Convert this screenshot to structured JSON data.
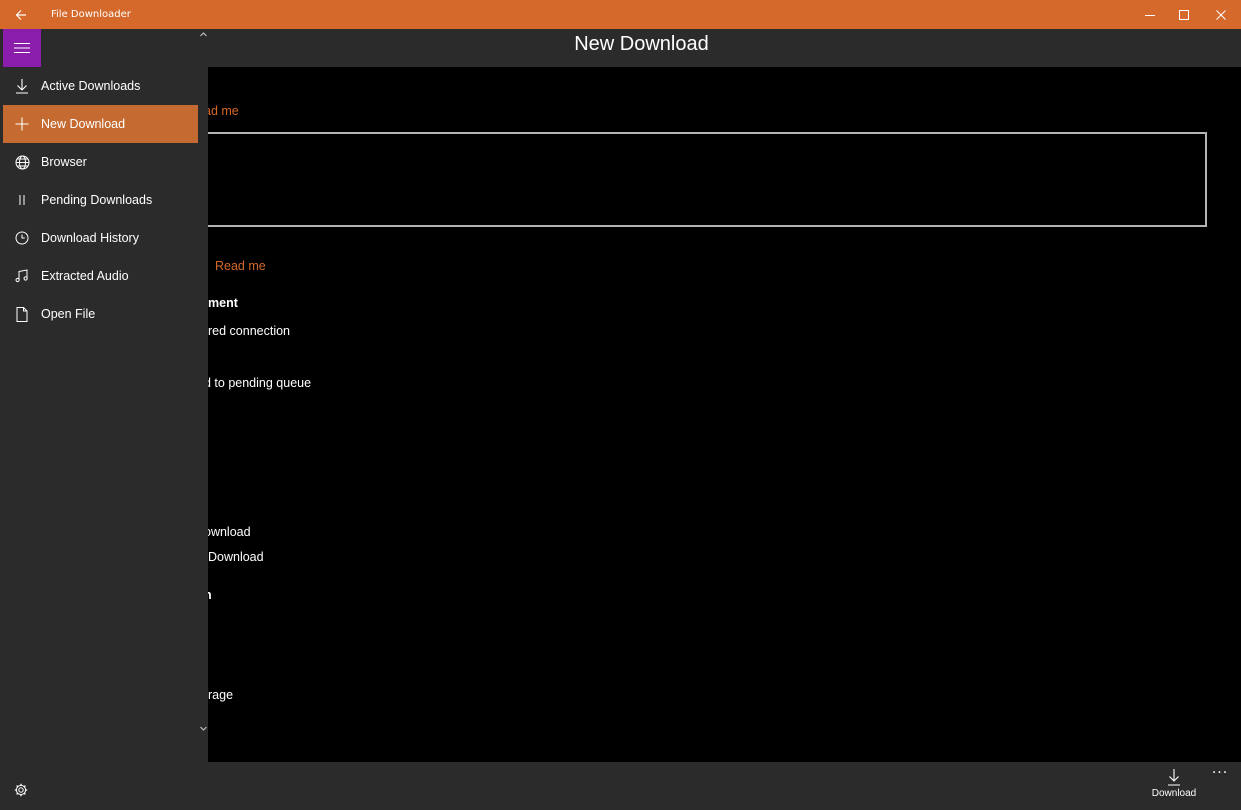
{
  "window": {
    "title": "File Downloader",
    "accent": "#d4692b"
  },
  "header": {
    "title": "New Download"
  },
  "content": {
    "link_1": "ad me",
    "link_2": "Read me",
    "heading_1": "ment",
    "lines": [
      "red connection",
      "d to pending queue",
      "ownload",
      "Download",
      "n",
      "rage"
    ]
  },
  "nav": {
    "hamburger_color": "#8a1dab",
    "items": [
      {
        "label": "Active Downloads",
        "icon": "download-icon"
      },
      {
        "label": "New Download",
        "icon": "plus-icon",
        "selected": true
      },
      {
        "label": "Browser",
        "icon": "globe-icon"
      },
      {
        "label": "Pending Downloads",
        "icon": "pause-icon"
      },
      {
        "label": "Download History",
        "icon": "clock-icon"
      },
      {
        "label": "Extracted Audio",
        "icon": "music-note-icon"
      },
      {
        "label": "Open File",
        "icon": "file-icon"
      }
    ]
  },
  "bottombar": {
    "download_label": "Download",
    "more": "···"
  }
}
